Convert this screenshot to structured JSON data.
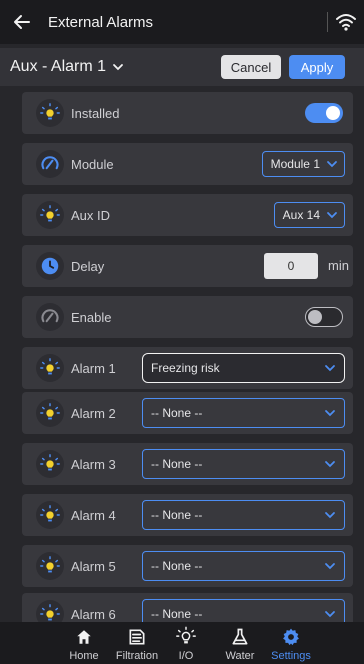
{
  "header": {
    "title": "External Alarms"
  },
  "selector": {
    "title": "Aux - Alarm 1",
    "cancel_label": "Cancel",
    "apply_label": "Apply"
  },
  "rows": {
    "installed": {
      "label": "Installed",
      "value": true
    },
    "module": {
      "label": "Module",
      "value": "Module 1"
    },
    "aux_id": {
      "label": "Aux ID",
      "value": "Aux 14"
    },
    "delay": {
      "label": "Delay",
      "value": "0",
      "unit": "min"
    },
    "enable": {
      "label": "Enable",
      "value": false
    }
  },
  "alarms": [
    {
      "label": "Alarm 1",
      "value": "Freezing risk"
    },
    {
      "label": "Alarm 2",
      "value": "-- None --"
    },
    {
      "label": "Alarm 3",
      "value": "-- None --"
    },
    {
      "label": "Alarm 4",
      "value": "-- None --"
    },
    {
      "label": "Alarm 5",
      "value": "-- None --"
    },
    {
      "label": "Alarm 6",
      "value": "-- None --"
    }
  ],
  "nav": [
    {
      "label": "Home",
      "icon": "home-icon"
    },
    {
      "label": "Filtration",
      "icon": "filtration-icon"
    },
    {
      "label": "I/O",
      "icon": "bulb-icon"
    },
    {
      "label": "Water",
      "icon": "flask-icon"
    },
    {
      "label": "Settings",
      "icon": "gear-icon",
      "active": true
    }
  ],
  "colors": {
    "accent": "#4d8df2",
    "background": "#27272b",
    "row": "#38383d",
    "bar": "#1b1b1e"
  }
}
